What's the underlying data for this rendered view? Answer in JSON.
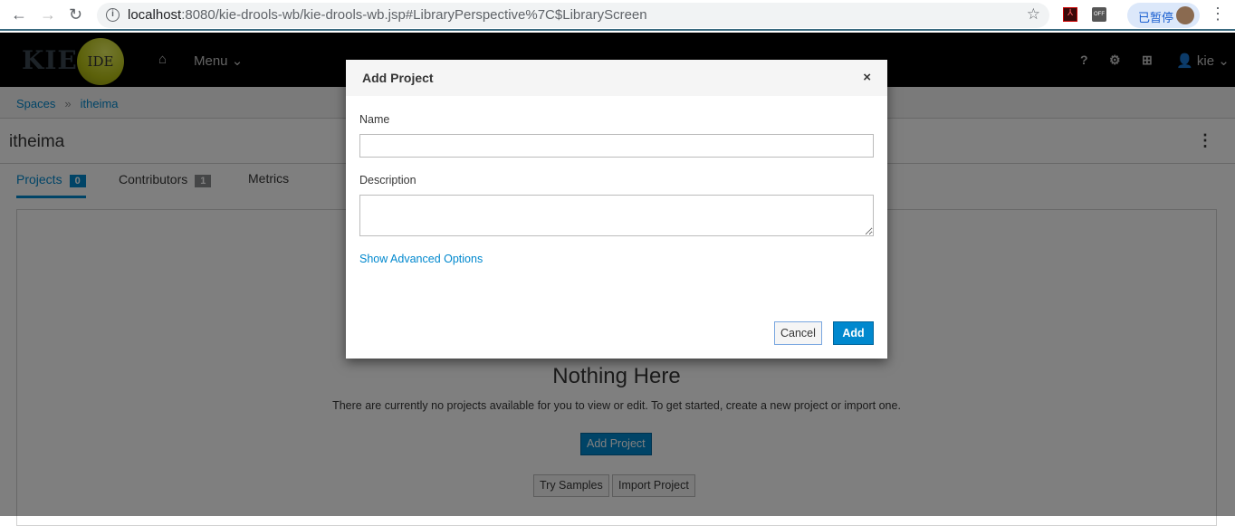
{
  "browser": {
    "url_host": "localhost",
    "url_rest": ":8080/kie-drools-wb/kie-drools-wb.jsp#LibraryPerspective%7C$LibraryScreen",
    "paused_label": "已暂停",
    "ext_off": "OFF"
  },
  "navbar": {
    "logo_text": "KIE",
    "logo_badge": "IDE",
    "menu_label": "Menu",
    "user_label": "kie",
    "icons": [
      "home-icon",
      "help-icon",
      "gear-icon",
      "briefcase-icon",
      "user-icon"
    ]
  },
  "breadcrumb": [
    {
      "label": "Spaces"
    },
    {
      "label": "itheima"
    }
  ],
  "title": "itheima",
  "tabs": [
    {
      "label": "Projects",
      "badge": "0",
      "active": true
    },
    {
      "label": "Contributors",
      "badge": "1"
    },
    {
      "label": "Metrics"
    }
  ],
  "empty": {
    "title": "Nothing Here",
    "text": "There are currently no projects available for you to view or edit. To get started, create a new project or import one.",
    "add_project": "Add Project",
    "try_samples": "Try Samples",
    "import_project": "Import Project"
  },
  "modal": {
    "title": "Add Project",
    "name_label": "Name",
    "name_value": "",
    "description_label": "Description",
    "description_value": "",
    "advanced_link": "Show Advanced Options",
    "cancel": "Cancel",
    "add": "Add"
  },
  "colors": {
    "accent": "#0088ce",
    "navbar": "#000000"
  }
}
